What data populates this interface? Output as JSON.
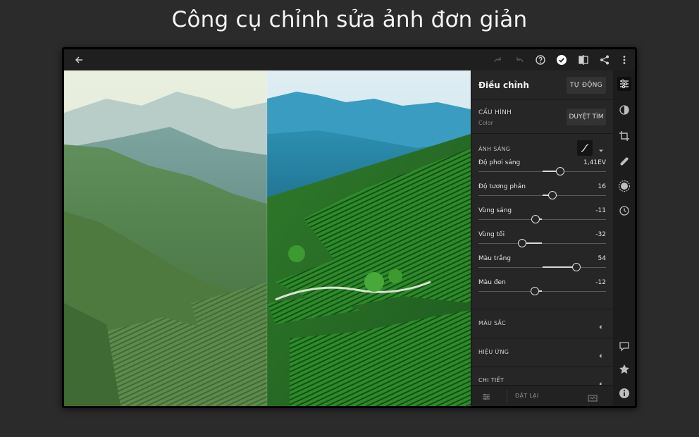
{
  "headline": "Công cụ chỉnh sửa ảnh đơn giản",
  "topbar": {
    "icons": [
      "back-arrow-icon",
      "redo-icon",
      "undo-icon",
      "help-icon",
      "done-check-icon",
      "compare-icon",
      "share-icon",
      "more-icon"
    ]
  },
  "panel": {
    "title": "Điều chỉnh",
    "auto_button": "TỰ ĐỘNG",
    "profile_label": "CẤU HÌNH",
    "profile_value": "Color",
    "browse_button": "DUYỆT TÌM",
    "light_header": "ÁNH SÁNG",
    "sliders": [
      {
        "label": "Độ phơi sáng",
        "value": "1,41EV",
        "level": 0.64
      },
      {
        "label": "Độ tương phản",
        "value": "16",
        "level": 0.58
      },
      {
        "label": "Vùng sáng",
        "value": "-11",
        "level": 0.45
      },
      {
        "label": "Vùng tối",
        "value": "-32",
        "level": 0.34
      },
      {
        "label": "Màu trắng",
        "value": "54",
        "level": 0.77
      },
      {
        "label": "Màu đen",
        "value": "-12",
        "level": 0.44
      }
    ],
    "sections": [
      "MÀU SẮC",
      "HIỆU ỨNG",
      "CHI TIẾT"
    ],
    "footer_reset": "ĐẶT LẠI"
  },
  "rail": {
    "icons": [
      "adjust-sliders-icon",
      "color-mix-icon",
      "crop-icon",
      "healing-brush-icon",
      "selective-icon",
      "history-icon",
      "comment-icon",
      "star-icon",
      "info-icon"
    ]
  },
  "colors": {
    "background": "#2b2b2b",
    "panel": "#262626",
    "accent": "#ffffff"
  }
}
